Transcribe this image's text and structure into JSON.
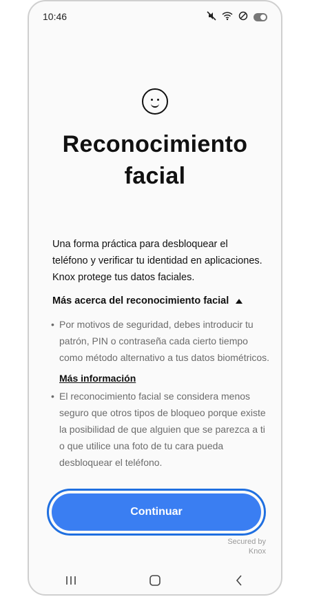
{
  "status_bar": {
    "time": "10:46"
  },
  "header": {
    "title_line1": "Reconocimiento",
    "title_line2": "facial"
  },
  "intro": "Una forma práctica para desbloquear el teléfono y verificar tu identidad en aplicaciones. Knox protege tus datos faciales.",
  "section": {
    "label": "Más acerca del reconocimiento facial",
    "bullets": [
      "Por motivos de seguridad, debes introducir tu patrón, PIN o contraseña cada cierto tiempo como método alternativo a tus datos biométricos.",
      "El reconocimiento facial se considera menos seguro que otros tipos de bloqueo porque existe la posibilidad de que alguien que se parezca a ti o que utilice una foto de tu cara pueda desbloquear el teléfono."
    ],
    "link": "Más información"
  },
  "cta": {
    "label": "Continuar"
  },
  "footer": {
    "secured_by_line1": "Secured by",
    "secured_by_line2": "Knox"
  },
  "nav": {
    "recents": "recents-icon",
    "home": "home-icon",
    "back": "back-icon"
  },
  "colors": {
    "primary": "#3a7ef2",
    "primary_border": "#1f6fe0"
  }
}
